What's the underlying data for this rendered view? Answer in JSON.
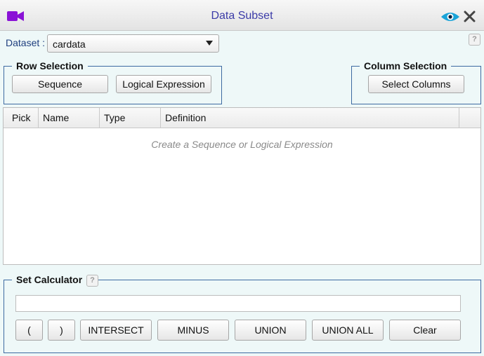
{
  "header": {
    "title": "Data Subset"
  },
  "dataset": {
    "label": "Dataset :",
    "selected": "cardata"
  },
  "help_label": "?",
  "row_selection": {
    "legend": "Row Selection",
    "sequence_label": "Sequence",
    "logical_label": "Logical Expression"
  },
  "column_selection": {
    "legend": "Column Selection",
    "select_columns_label": "Select Columns"
  },
  "grid": {
    "columns": [
      "Pick",
      "Name",
      "Type",
      "Definition"
    ],
    "empty_message": "Create a Sequence or Logical Expression"
  },
  "set_calculator": {
    "legend": "Set Calculator",
    "expression_value": "",
    "buttons": {
      "open_paren": "(",
      "close_paren": ")",
      "intersect": "INTERSECT",
      "minus": "MINUS",
      "union": "UNION",
      "union_all": "UNION ALL",
      "clear": "Clear"
    }
  },
  "colors": {
    "title_text": "#3b3ba8",
    "icon_purple": "#8a12d6",
    "eye_blue": "#1aa3d8",
    "group_border": "#3d6aa1",
    "background": "#eef8f8"
  },
  "icons": {
    "header_left": "video-camera-icon",
    "header_right_1": "eye-icon",
    "header_right_2": "close-icon"
  }
}
